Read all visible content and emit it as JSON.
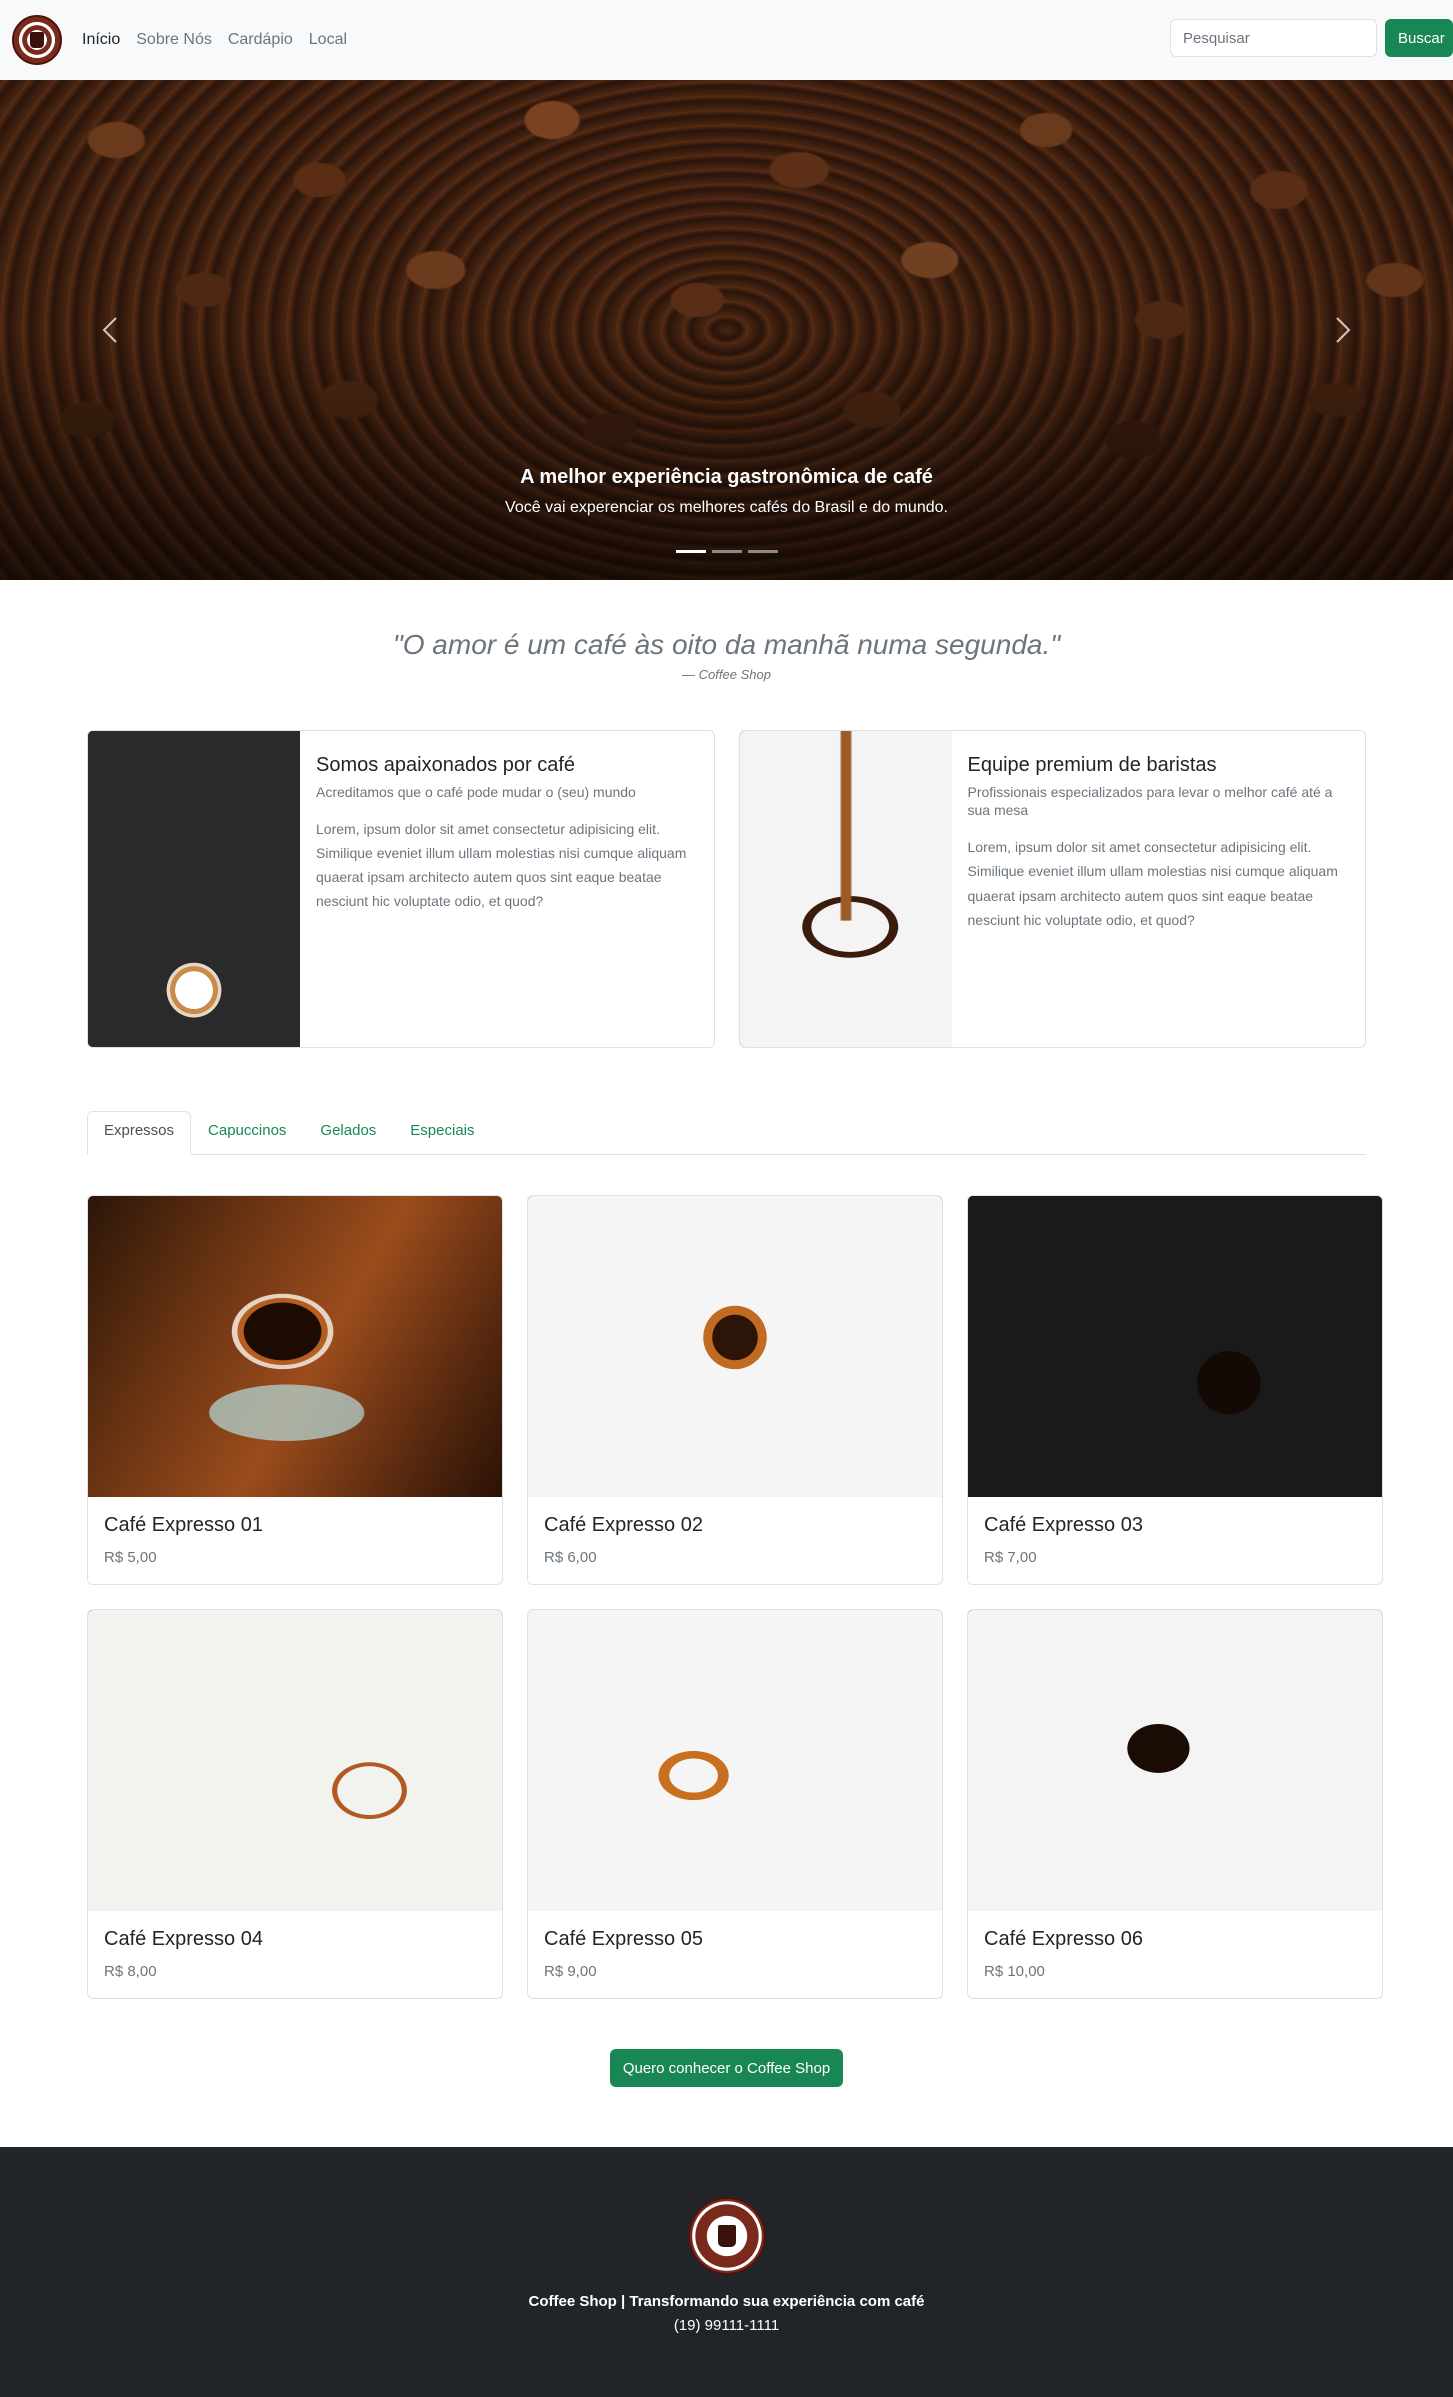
{
  "nav": {
    "links": [
      "Início",
      "Sobre Nós",
      "Cardápio",
      "Local"
    ],
    "search_placeholder": "Pesquisar",
    "search_button": "Buscar"
  },
  "hero": {
    "title": "A melhor experiência gastronômica de café",
    "subtitle": "Você vai experenciar os melhores cafés do Brasil e do mundo."
  },
  "quote": {
    "text": "\"O amor é um café às oito da manhã numa segunda.\"",
    "source": "— Coffee Shop"
  },
  "features": [
    {
      "title": "Somos apaixonados por café",
      "subtitle": "Acreditamos que o café pode mudar o (seu) mundo",
      "text": "Lorem, ipsum dolor sit amet consectetur adipisicing elit. Similique eveniet illum ullam molestias nisi cumque aliquam quaerat ipsam architecto autem quos sint eaque beatae nesciunt hic voluptate odio, et quod?"
    },
    {
      "title": "Equipe premium de baristas",
      "subtitle": "Profissionais especializados para levar o melhor café até a sua mesa",
      "text": "Lorem, ipsum dolor sit amet consectetur adipisicing elit. Similique eveniet illum ullam molestias nisi cumque aliquam quaerat ipsam architecto autem quos sint eaque beatae nesciunt hic voluptate odio, et quod?"
    }
  ],
  "tabs": [
    "Expressos",
    "Capuccinos",
    "Gelados",
    "Especiais"
  ],
  "products": [
    {
      "name": "Café Expresso 01",
      "price": "R$ 5,00"
    },
    {
      "name": "Café Expresso 02",
      "price": "R$ 6,00"
    },
    {
      "name": "Café Expresso 03",
      "price": "R$ 7,00"
    },
    {
      "name": "Café Expresso 04",
      "price": "R$ 8,00"
    },
    {
      "name": "Café Expresso 05",
      "price": "R$ 9,00"
    },
    {
      "name": "Café Expresso 06",
      "price": "R$ 10,00"
    }
  ],
  "cta": {
    "label": "Quero conhecer o Coffee Shop"
  },
  "footer": {
    "title": "Coffee Shop | Transformando sua experiência com café",
    "phone": "(19) 99111-1111"
  }
}
